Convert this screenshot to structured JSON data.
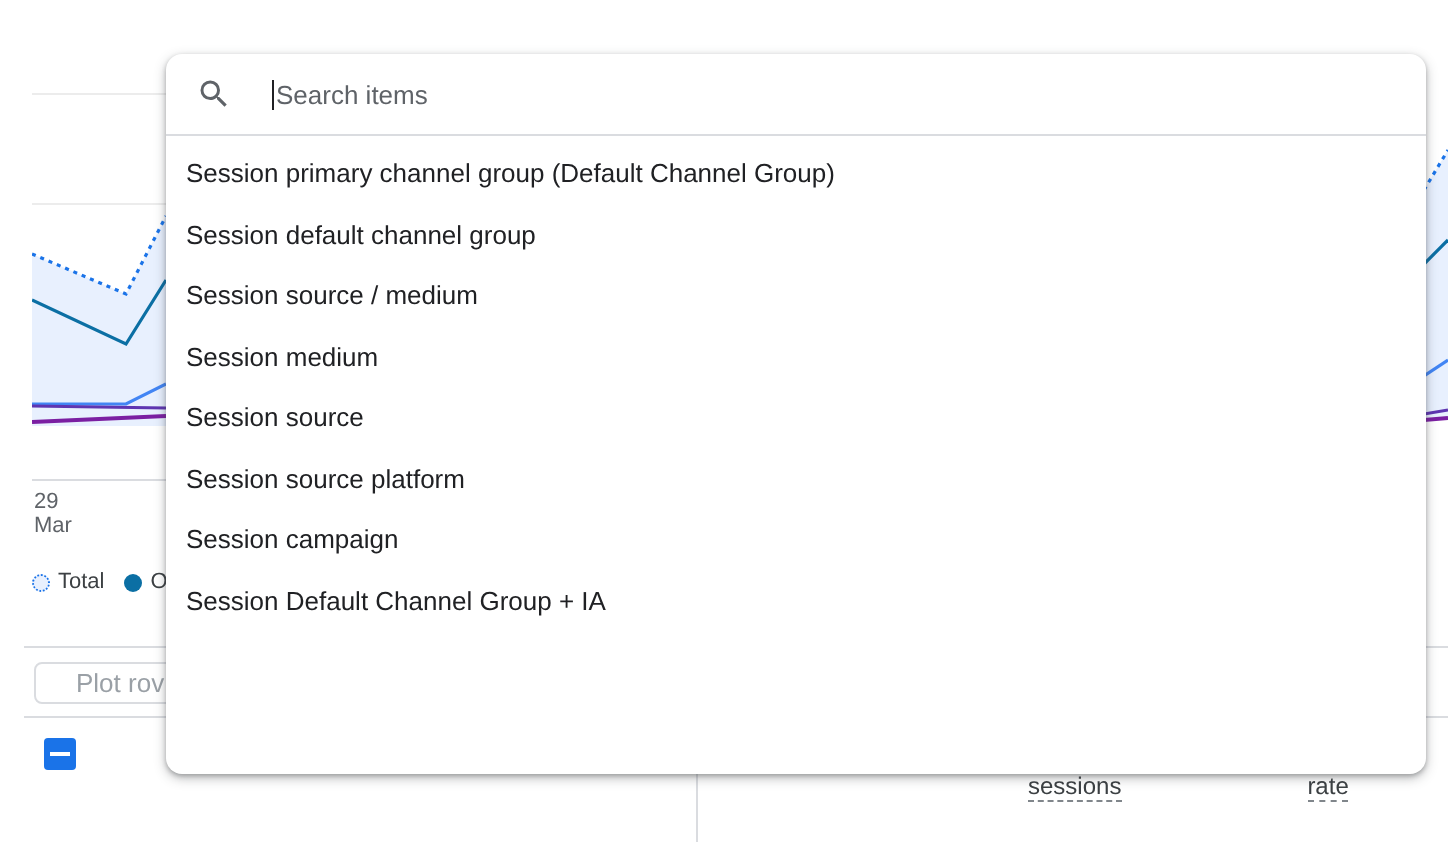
{
  "chart": {
    "axis_label": {
      "day": "29",
      "month": "Mar"
    },
    "legend": [
      {
        "label": "Total",
        "kind": "dotted",
        "color": "#1a73e8"
      },
      {
        "label": "O",
        "kind": "solid",
        "color": "#0b6fa4"
      }
    ]
  },
  "plot_button": "Plot rov",
  "table": {
    "select_all": {
      "indeterminate": true
    },
    "columns": [
      "sessions",
      "rate"
    ]
  },
  "dropdown": {
    "search": {
      "placeholder": "Search items"
    },
    "items": [
      "Session primary channel group (Default Channel Group)",
      "Session default channel group",
      "Session source / medium",
      "Session medium",
      "Session source",
      "Session source platform",
      "Session campaign",
      "Session Default Channel Group + IA"
    ]
  }
}
